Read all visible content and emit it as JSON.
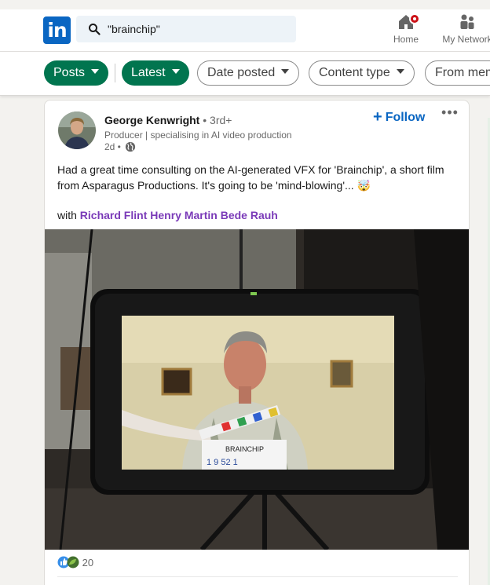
{
  "header": {
    "logo_text": "in",
    "search_value": "\"brainchip\"",
    "nav": [
      {
        "label": "Home",
        "icon": "home-icon"
      },
      {
        "label": "My Network",
        "icon": "people-icon"
      }
    ],
    "brand_color": "#0a66c2",
    "notification_color": "#cc1016"
  },
  "filters": {
    "active_color": "#01754f",
    "pills": [
      {
        "label": "Posts",
        "active": true
      },
      {
        "label": "Latest",
        "active": true
      },
      {
        "label": "Date posted",
        "active": false
      },
      {
        "label": "Content type",
        "active": false
      },
      {
        "label": "From member",
        "active": false
      }
    ]
  },
  "post": {
    "author": "George Kenwright",
    "degree": "• 3rd+",
    "headline": "Producer | specialising in AI video production",
    "time": "2d •",
    "visibility_icon": "globe-icon",
    "follow_label": "Follow",
    "more_label": "•••",
    "text": "Had a great time consulting on the AI-generated VFX for 'Brainchip', a short film from Asparagus Productions. It's going to be 'mind-blowing'... 🤯",
    "with_label": "with",
    "mentions": "Richard Flint Henry Martin Bede Rauh",
    "clapper_title": "BRAINCHIP",
    "clapper_numbers": "1  9  52  1",
    "reaction_count": "20",
    "reaction_icons": [
      "like-icon",
      "support-icon"
    ]
  }
}
